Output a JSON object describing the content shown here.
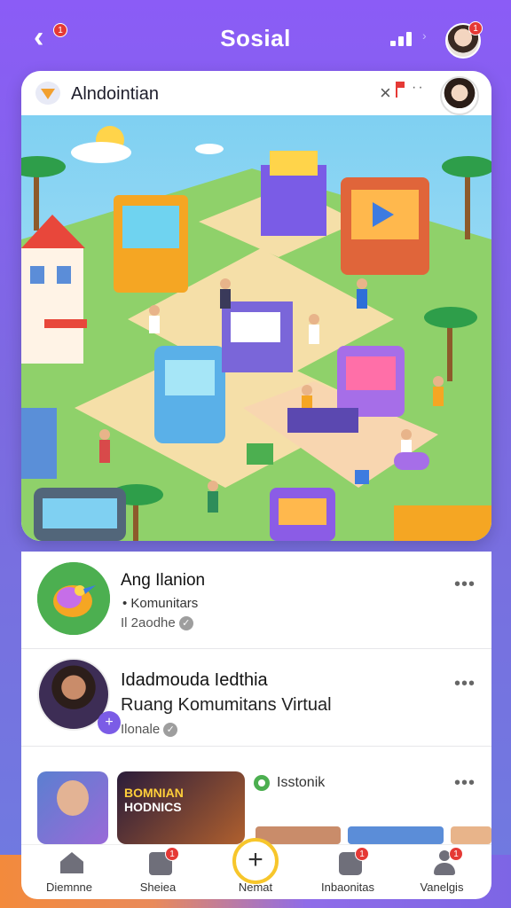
{
  "header": {
    "title": "Sosial",
    "back_badge": "1",
    "avatar_badge": "1"
  },
  "card": {
    "title": "Alndointian"
  },
  "list": [
    {
      "title": "Ang Ilanion",
      "subtitle": "Komunitars",
      "meta": "Il 2aodhe",
      "more": "•••"
    },
    {
      "title": "Idadmouda Iedthia",
      "subtitle": "Ruang Komumitans Virtual",
      "meta": "Ilonale",
      "more": "•••"
    },
    {
      "thumb_text_1": "BOMNIAN",
      "thumb_text_2": "HODNICS",
      "label": "Isstonik",
      "more": "•••"
    }
  ],
  "nav": [
    {
      "label": "Diemnne",
      "icon": "home-icon"
    },
    {
      "label": "Sheiea",
      "icon": "inbox-icon",
      "badge": "1"
    },
    {
      "label": "Nemat",
      "icon": "add-circle-icon"
    },
    {
      "label": "Inbaonitas",
      "icon": "grid-icon",
      "badge": "1"
    },
    {
      "label": "Vanelgis",
      "icon": "profile-icon",
      "badge": "1"
    }
  ],
  "colors": {
    "accent": "#7b5ce6",
    "badge": "#e53935",
    "highlight": "#f7c62b"
  }
}
